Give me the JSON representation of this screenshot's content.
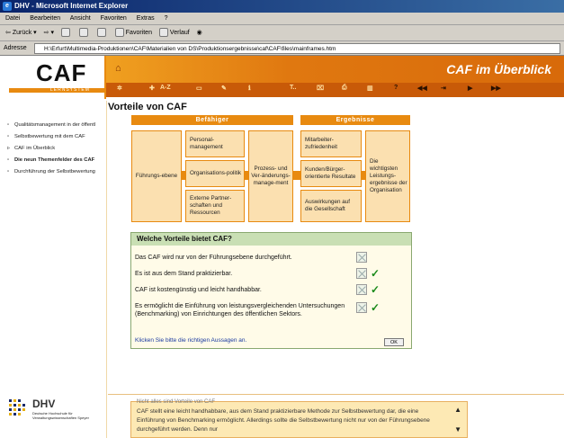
{
  "window": {
    "title": "DHV - Microsoft Internet Explorer"
  },
  "menu": [
    "Datei",
    "Bearbeiten",
    "Ansicht",
    "Favoriten",
    "Extras",
    "?"
  ],
  "toolbar": {
    "back": "Zurück",
    "favorites": "Favoriten",
    "history": "Verlauf"
  },
  "address": {
    "label": "Adresse",
    "url": "H:\\Erfurt\\Multimedia-Produktionen\\CAF\\Materialien von DS\\Produktionsergebnisse\\caf\\CAF\\files\\mainframes.htm"
  },
  "header": {
    "logo": "CAF",
    "logo_sub": "LERNSYSTEM",
    "title": "CAF im Überblick",
    "nav_az": "A-Z",
    "nav_help": "?"
  },
  "sidebar": {
    "items": [
      "Qualitätsmanagement in der öffentl",
      "Selbstbewertung mit dem CAF",
      "CAF im Überblick",
      "Die neun Themenfelder des CAF",
      "Durchführung der Selbstbewertung"
    ],
    "dhv_name": "DHV",
    "dhv_sub": "Deutsche Hochschule für Verwaltungswissenschaften Speyer"
  },
  "page": {
    "title": "Vorteile von CAF"
  },
  "diagram": {
    "band_left": "Befähiger",
    "band_right": "Ergebnisse",
    "fuehrung": "Führungs-ebene",
    "personal": "Personal-management",
    "politik": "Organisations-politik",
    "partner": "Externe Partner-schaften und Ressourcen",
    "prozess": "Prozess- und Ver-änderungs-manage-ment",
    "mitarbeiter": "Mitarbeiter-zufriedenheit",
    "kunden": "Kunden/Bürger-orientierte Resultate",
    "gesellschaft": "Auswirkungen auf die Gesellschaft",
    "ergebnisse": "Die wichtigsten Leistungs-ergebnisse der Organisation"
  },
  "quiz": {
    "title": "Welche Vorteile bietet CAF?",
    "statements": [
      {
        "text": "Das CAF wird nur von der Führungsebene durchgeführt.",
        "checked": false
      },
      {
        "text": "Es ist aus dem Stand praktizierbar.",
        "checked": true
      },
      {
        "text": "CAF ist kostengünstig und leicht handhabbar.",
        "checked": true
      },
      {
        "text": "Es ermöglicht die Einführung von leistungsvergleichenden Untersuchungen (Benchmarking) von Einrichtungen des öffentlichen Sektors.",
        "checked": true
      }
    ],
    "footer": "Klicken Sie bitte die richtigen Aussagen an.",
    "ok_label": "OK"
  },
  "feedback": {
    "cut_line": "Nicht alles sind Vorteile von CAF",
    "text": "CAF stellt eine leicht handhabbare, aus dem Stand praktizierbare Methode zur Selbstbewertung dar, die eine Einführung von Benchmarking ermöglicht. Allerdings sollte die Selbstbewertung nicht nur von der Führungsebene durchgeführt werden. Denn nur"
  },
  "colors": {
    "accent": "#e88a10",
    "box": "#fbe0b0",
    "quiz_head": "#c9dfb4",
    "check": "#1a8a1a"
  }
}
